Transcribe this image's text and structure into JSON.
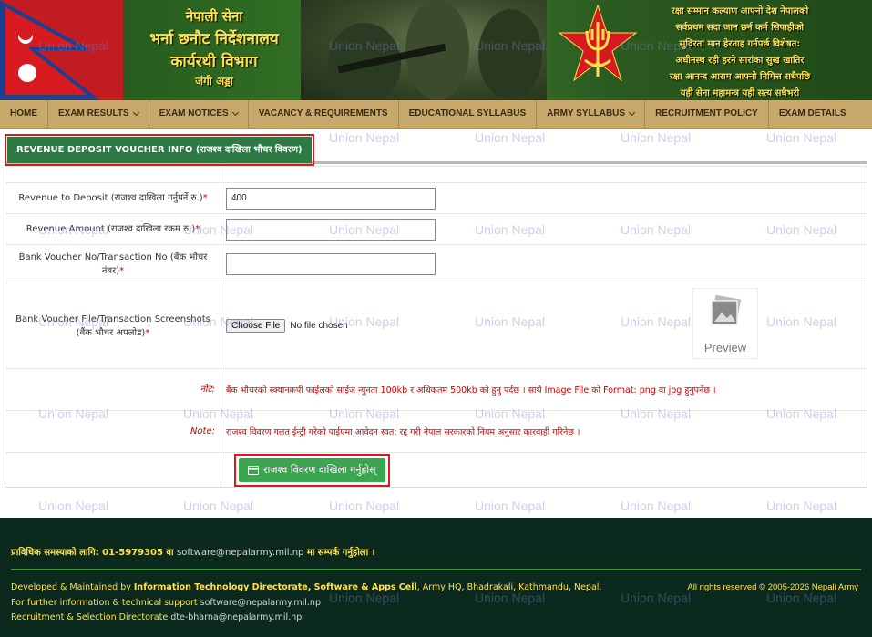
{
  "banner": {
    "line1": "नेपाली सेना",
    "line2": "भर्ना छनौट निर्देशनालय",
    "line3": "कार्यरथी विभाग",
    "line4": "जंगी अड्डा",
    "motto": [
      "रक्षा सम्मान कल्याण आफ्नो देश नेपालको",
      "सर्वप्रथम सदा जान छर्न कर्म सिपाहीको",
      "सुविरता मान हेरताह गर्नपर्छ विशेषत:",
      "अधीनस्थ रही हरने सारांका सुख खातिर",
      "रक्षा आनन्द आराम आफ्नो निमित्त सधैपछि",
      "यही सेना महामन्त्र यही सत्य सधैभरी"
    ],
    "flag_red": "#d71920",
    "flag_blue": "#1d3f8f"
  },
  "nav": [
    {
      "label": "HOME",
      "dropdown": false
    },
    {
      "label": "EXAM RESULTS",
      "dropdown": true
    },
    {
      "label": "EXAM NOTICES",
      "dropdown": true
    },
    {
      "label": "VACANCY & REQUIREMENTS",
      "dropdown": false
    },
    {
      "label": "EDUCATIONAL SYLLABUS",
      "dropdown": false
    },
    {
      "label": "ARMY SYLLABUS",
      "dropdown": true
    },
    {
      "label": "RECRUITMENT POLICY",
      "dropdown": false
    },
    {
      "label": "EXAM DETAILS",
      "dropdown": false
    }
  ],
  "tab": {
    "label": "REVENUE DEPOSIT VOUCHER INFO (राजश्व दाखिला भौचर विवरण)"
  },
  "form": {
    "revenue_to_deposit": {
      "label": "Revenue to Deposit (राजश्व दाखिला गर्नुपर्ने रु.)",
      "required": "*",
      "value": "400"
    },
    "revenue_amount": {
      "label": "Revenue Amount (राजश्व दाखिला रकम रु.)",
      "required": "*",
      "value": ""
    },
    "voucher_no": {
      "label": "Bank Voucher No/Transaction No (बैंक भौचर नंबर)",
      "required": "*",
      "value": ""
    },
    "voucher_file": {
      "label": "Bank Voucher File/Transaction Screenshots (बैंक भौचर अपलोड)",
      "required": "*",
      "button": "Choose File",
      "status": "No file chosen",
      "preview": "Preview"
    },
    "note1": {
      "label": "नोट:",
      "text": "बैंक भौचरको स्क्यानकपी फाईलको साईज न्युनता 100kb र अधिकतम 500kb को हुनु पर्दछ । साथै Image File को Format: png वा jpg हुनुपर्नेछ ।"
    },
    "note2": {
      "label": "Note:",
      "text": "राजश्व विवरण गलत ईन्ट्री गरेको पाईएमा आवेदन स्वत: रद्द गरी नेपाल सरकारको नियम अनुसार कारवाही गरिनेछ ।"
    },
    "submit": {
      "label": "राजश्व विवरण दाखिला गर्नुहोस्"
    }
  },
  "footer": {
    "support_pre": "प्राविधिक समस्याको लागि: 01-5979305 वा ",
    "support_email": "software@nepalarmy.mil.np",
    "support_post": " मा सम्पर्क गर्नुहोला ।",
    "dev_pre": "Developed & Maintained by ",
    "dev_bold": "Information Technology Directorate, Software & Apps Cell",
    "dev_post": ", Army HQ, Bhadrakali, Kathmandu, Nepal.",
    "info_label": "For further information & technical support",
    "info_email": "software@nepalarmy.mil.np",
    "rsd_label": "Recruitment & Selection Directorate",
    "rsd_email": "dte-bharna@nepalarmy.mil.np",
    "copyright": "All rights reserved © 2005-2026 Nepali Army"
  },
  "watermark": "Union Nepal"
}
